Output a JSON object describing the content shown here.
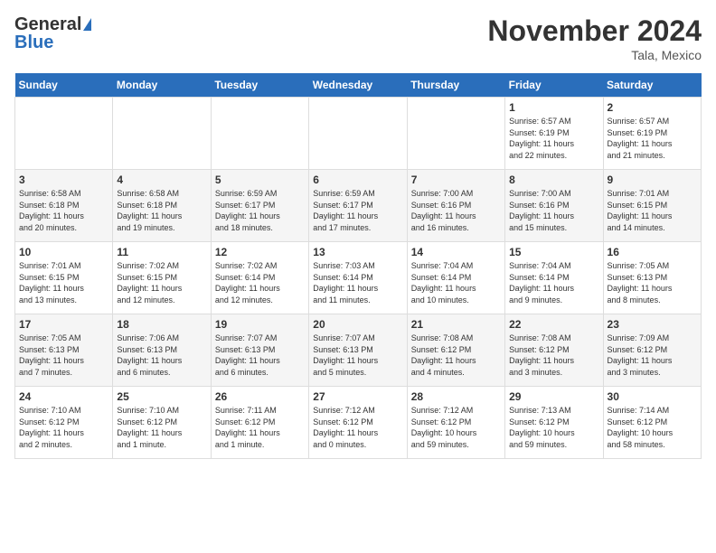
{
  "header": {
    "logo_general": "General",
    "logo_blue": "Blue",
    "month_title": "November 2024",
    "location": "Tala, Mexico"
  },
  "days_of_week": [
    "Sunday",
    "Monday",
    "Tuesday",
    "Wednesday",
    "Thursday",
    "Friday",
    "Saturday"
  ],
  "weeks": [
    [
      {
        "day": "",
        "text": ""
      },
      {
        "day": "",
        "text": ""
      },
      {
        "day": "",
        "text": ""
      },
      {
        "day": "",
        "text": ""
      },
      {
        "day": "",
        "text": ""
      },
      {
        "day": "1",
        "text": "Sunrise: 6:57 AM\nSunset: 6:19 PM\nDaylight: 11 hours\nand 22 minutes."
      },
      {
        "day": "2",
        "text": "Sunrise: 6:57 AM\nSunset: 6:19 PM\nDaylight: 11 hours\nand 21 minutes."
      }
    ],
    [
      {
        "day": "3",
        "text": "Sunrise: 6:58 AM\nSunset: 6:18 PM\nDaylight: 11 hours\nand 20 minutes."
      },
      {
        "day": "4",
        "text": "Sunrise: 6:58 AM\nSunset: 6:18 PM\nDaylight: 11 hours\nand 19 minutes."
      },
      {
        "day": "5",
        "text": "Sunrise: 6:59 AM\nSunset: 6:17 PM\nDaylight: 11 hours\nand 18 minutes."
      },
      {
        "day": "6",
        "text": "Sunrise: 6:59 AM\nSunset: 6:17 PM\nDaylight: 11 hours\nand 17 minutes."
      },
      {
        "day": "7",
        "text": "Sunrise: 7:00 AM\nSunset: 6:16 PM\nDaylight: 11 hours\nand 16 minutes."
      },
      {
        "day": "8",
        "text": "Sunrise: 7:00 AM\nSunset: 6:16 PM\nDaylight: 11 hours\nand 15 minutes."
      },
      {
        "day": "9",
        "text": "Sunrise: 7:01 AM\nSunset: 6:15 PM\nDaylight: 11 hours\nand 14 minutes."
      }
    ],
    [
      {
        "day": "10",
        "text": "Sunrise: 7:01 AM\nSunset: 6:15 PM\nDaylight: 11 hours\nand 13 minutes."
      },
      {
        "day": "11",
        "text": "Sunrise: 7:02 AM\nSunset: 6:15 PM\nDaylight: 11 hours\nand 12 minutes."
      },
      {
        "day": "12",
        "text": "Sunrise: 7:02 AM\nSunset: 6:14 PM\nDaylight: 11 hours\nand 12 minutes."
      },
      {
        "day": "13",
        "text": "Sunrise: 7:03 AM\nSunset: 6:14 PM\nDaylight: 11 hours\nand 11 minutes."
      },
      {
        "day": "14",
        "text": "Sunrise: 7:04 AM\nSunset: 6:14 PM\nDaylight: 11 hours\nand 10 minutes."
      },
      {
        "day": "15",
        "text": "Sunrise: 7:04 AM\nSunset: 6:14 PM\nDaylight: 11 hours\nand 9 minutes."
      },
      {
        "day": "16",
        "text": "Sunrise: 7:05 AM\nSunset: 6:13 PM\nDaylight: 11 hours\nand 8 minutes."
      }
    ],
    [
      {
        "day": "17",
        "text": "Sunrise: 7:05 AM\nSunset: 6:13 PM\nDaylight: 11 hours\nand 7 minutes."
      },
      {
        "day": "18",
        "text": "Sunrise: 7:06 AM\nSunset: 6:13 PM\nDaylight: 11 hours\nand 6 minutes."
      },
      {
        "day": "19",
        "text": "Sunrise: 7:07 AM\nSunset: 6:13 PM\nDaylight: 11 hours\nand 6 minutes."
      },
      {
        "day": "20",
        "text": "Sunrise: 7:07 AM\nSunset: 6:13 PM\nDaylight: 11 hours\nand 5 minutes."
      },
      {
        "day": "21",
        "text": "Sunrise: 7:08 AM\nSunset: 6:12 PM\nDaylight: 11 hours\nand 4 minutes."
      },
      {
        "day": "22",
        "text": "Sunrise: 7:08 AM\nSunset: 6:12 PM\nDaylight: 11 hours\nand 3 minutes."
      },
      {
        "day": "23",
        "text": "Sunrise: 7:09 AM\nSunset: 6:12 PM\nDaylight: 11 hours\nand 3 minutes."
      }
    ],
    [
      {
        "day": "24",
        "text": "Sunrise: 7:10 AM\nSunset: 6:12 PM\nDaylight: 11 hours\nand 2 minutes."
      },
      {
        "day": "25",
        "text": "Sunrise: 7:10 AM\nSunset: 6:12 PM\nDaylight: 11 hours\nand 1 minute."
      },
      {
        "day": "26",
        "text": "Sunrise: 7:11 AM\nSunset: 6:12 PM\nDaylight: 11 hours\nand 1 minute."
      },
      {
        "day": "27",
        "text": "Sunrise: 7:12 AM\nSunset: 6:12 PM\nDaylight: 11 hours\nand 0 minutes."
      },
      {
        "day": "28",
        "text": "Sunrise: 7:12 AM\nSunset: 6:12 PM\nDaylight: 10 hours\nand 59 minutes."
      },
      {
        "day": "29",
        "text": "Sunrise: 7:13 AM\nSunset: 6:12 PM\nDaylight: 10 hours\nand 59 minutes."
      },
      {
        "day": "30",
        "text": "Sunrise: 7:14 AM\nSunset: 6:12 PM\nDaylight: 10 hours\nand 58 minutes."
      }
    ]
  ]
}
